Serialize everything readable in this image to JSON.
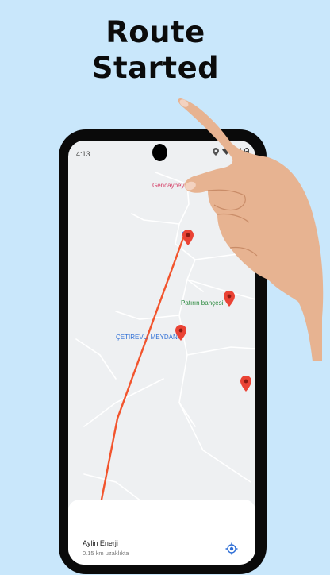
{
  "headline": {
    "line1": "Route",
    "line2": "Started"
  },
  "status_bar": {
    "time": "4:13"
  },
  "map": {
    "labels": {
      "gencaybey": "Gencaybey",
      "patirin": "Patırın bahçesi",
      "cetirevli": "ÇETİREVLİ MEYDANI"
    },
    "route_color": "#f2542d",
    "pin_color": "#ea4335"
  },
  "bottom_sheet": {
    "station_name": "Aylin Enerji",
    "distance": "0.15 km uzaklıkta"
  },
  "icons": [
    "location-pin-icon",
    "wifi-icon",
    "signal-icon",
    "battery-icon",
    "my-location-icon"
  ]
}
